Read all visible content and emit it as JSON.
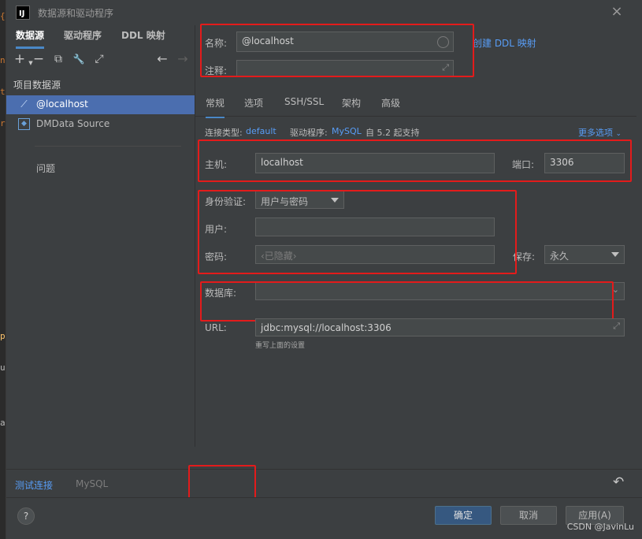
{
  "window": {
    "title": "数据源和驱动程序",
    "close_icon": "×"
  },
  "left_tabs": [
    "数据源",
    "驱动程序",
    "DDL 映射"
  ],
  "left_toolbar": {
    "add": "+",
    "remove": "−",
    "copy": "⧉",
    "settings": "🔧",
    "export": "⤢",
    "back": "←",
    "forward": "→"
  },
  "project_section": "项目数据源",
  "datasources": [
    {
      "label": "@localhost",
      "icon": "mysql-icon",
      "selected": true
    },
    {
      "label": "DMData Source",
      "icon": "dm-icon",
      "selected": false
    }
  ],
  "problems_label": "问题",
  "form": {
    "name_label": "名称:",
    "name_value": "@localhost",
    "create_ddl_link": "创建 DDL 映射",
    "comment_label": "注释:",
    "comment_value": "",
    "tabs": [
      "常规",
      "选项",
      "SSH/SSL",
      "架构",
      "高级"
    ],
    "connection_type_label": "连接类型:",
    "connection_type_value": "default",
    "driver_label": "驱动程序:",
    "driver_value": "MySQL",
    "driver_note": "自 5.2 起支持",
    "more_options": "更多选项",
    "host_label": "主机:",
    "host_value": "localhost",
    "port_label": "端口:",
    "port_value": "3306",
    "auth_label": "身份验证:",
    "auth_value": "用户与密码",
    "user_label": "用户:",
    "user_value": "",
    "password_label": "密码:",
    "password_placeholder": "‹已隐藏›",
    "save_label": "保存:",
    "save_value": "永久",
    "database_label": "数据库:",
    "database_value": "",
    "url_label": "URL:",
    "url_value": "jdbc:mysql://localhost:3306",
    "url_note": "重写上面的设置"
  },
  "bottom": {
    "test_connection": "测试连接",
    "mysql_tab": "MySQL",
    "reset_icon": "↶"
  },
  "footer": {
    "help": "?",
    "ok": "确定",
    "cancel": "取消",
    "apply": "应用(A)"
  },
  "watermark": "CSDN @JavinLu",
  "colors": {
    "accent": "#589df6",
    "selection": "#4b6eaf",
    "highlight_box": "#e31b1b"
  }
}
